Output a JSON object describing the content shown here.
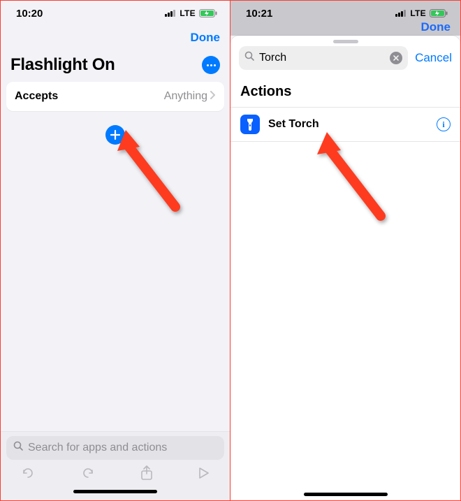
{
  "left": {
    "status": {
      "time": "10:20",
      "network": "LTE"
    },
    "nav": {
      "done": "Done"
    },
    "title": "Flashlight On",
    "accepts": {
      "label": "Accepts",
      "value": "Anything"
    },
    "bottom_search_placeholder": "Search for apps and actions"
  },
  "right": {
    "status": {
      "time": "10:21",
      "network": "LTE"
    },
    "done_ghost": "Done",
    "search": {
      "query": "Torch",
      "cancel": "Cancel"
    },
    "section_title": "Actions",
    "result": {
      "label": "Set Torch"
    }
  }
}
